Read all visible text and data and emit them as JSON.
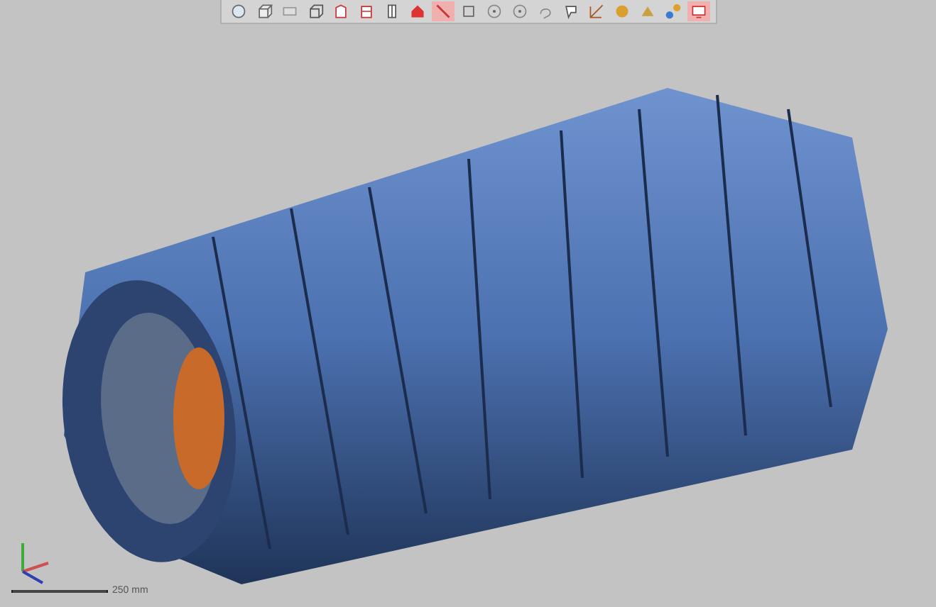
{
  "toolbar": {
    "tools": [
      {
        "kind": "sphere",
        "selected": false
      },
      {
        "kind": "cube",
        "selected": false
      },
      {
        "kind": "plane",
        "selected": false
      },
      {
        "kind": "box",
        "selected": false
      },
      {
        "kind": "section",
        "selected": false
      },
      {
        "kind": "section2",
        "selected": false
      },
      {
        "kind": "bars",
        "selected": false
      },
      {
        "kind": "house",
        "selected": false
      },
      {
        "kind": "line",
        "selected": true
      },
      {
        "kind": "rect",
        "selected": false
      },
      {
        "kind": "circle",
        "selected": false
      },
      {
        "kind": "circle",
        "selected": false
      },
      {
        "kind": "lasso",
        "selected": false
      },
      {
        "kind": "brush",
        "selected": false
      },
      {
        "kind": "pen",
        "selected": false
      },
      {
        "kind": "gold",
        "selected": false
      },
      {
        "kind": "gold2",
        "selected": false
      },
      {
        "kind": "link",
        "selected": false
      },
      {
        "kind": "screen",
        "selected": true
      }
    ]
  },
  "viewport": {
    "scale_label": "250 mm"
  }
}
